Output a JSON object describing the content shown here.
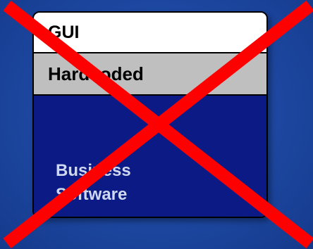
{
  "layers": {
    "gui": "GUI",
    "hardcoded": "Hardcoded",
    "business_line1": "Business",
    "business_line2": "Software"
  },
  "colors": {
    "background": "#1d47a0",
    "gui_layer": "#ffffff",
    "hardcoded_layer": "#bfbfbf",
    "business_layer": "#0c1a86",
    "cross": "#ff0000"
  }
}
